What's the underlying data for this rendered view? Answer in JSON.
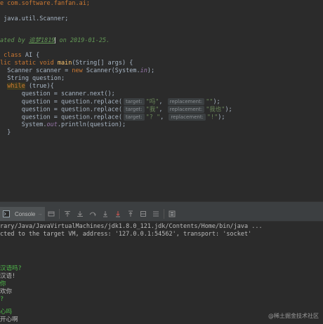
{
  "code": {
    "pkg": "e com.software.fanfan.ai;",
    "imp": " java.util.Scanner;",
    "author_prefix": "ated by ",
    "author_name": "追梦1819",
    "author_suffix": " on 2019-01-25.",
    "class_kw": " class ",
    "class_name": "AI {",
    "main_kw": "lic static void ",
    "main_name": "main",
    "main_rest": "(String[] args) {",
    "l_scanner_a": "  Scanner scanner = ",
    "l_scanner_new": "new",
    "l_scanner_b": " Scanner(System.",
    "l_scanner_in": "in",
    "l_scanner_c": ");",
    "l_question": "  String question;",
    "l_while_kw": "while",
    "l_while_rest": " (true){",
    "l_next": "      question = scanner.next();",
    "l_replace": "      question = question.replace(",
    "r1_t": "\"吗\"",
    "r1_r": "\"\"",
    "r2_t": "\"我\"",
    "r2_r": "\"我也\"",
    "r3_t": "\"? \"",
    "r3_r": "\"!\"",
    "hint_target": "target:",
    "hint_replacement": "replacement:",
    "close_paren": ");",
    "l_print_a": "      System.",
    "l_print_out": "out",
    "l_print_b": ".println(question);",
    "l_close": "  }"
  },
  "console_tab": {
    "label": "Console",
    "arrow": "→"
  },
  "console": {
    "path": "rary/Java/JavaVirtualMachines/jdk1.8.0_121.jdk/Contents/Home/bin/java ...",
    "connected": "cted to the target VM, address: '127.0.0.1:54562', transport: 'socket'",
    "io": [
      {
        "text": "汉语吗?",
        "kind": "in"
      },
      {
        "text": "汉语!",
        "kind": "out"
      },
      {
        "text": "你",
        "kind": "in"
      },
      {
        "text": "欢你",
        "kind": "out"
      },
      {
        "text": "?",
        "kind": "in"
      },
      {
        "text": "",
        "kind": "out"
      },
      {
        "text": "心吗",
        "kind": "in"
      },
      {
        "text": "开心啊",
        "kind": "out"
      }
    ]
  },
  "watermark": {
    "text": "@稀土掘金技术社区"
  }
}
